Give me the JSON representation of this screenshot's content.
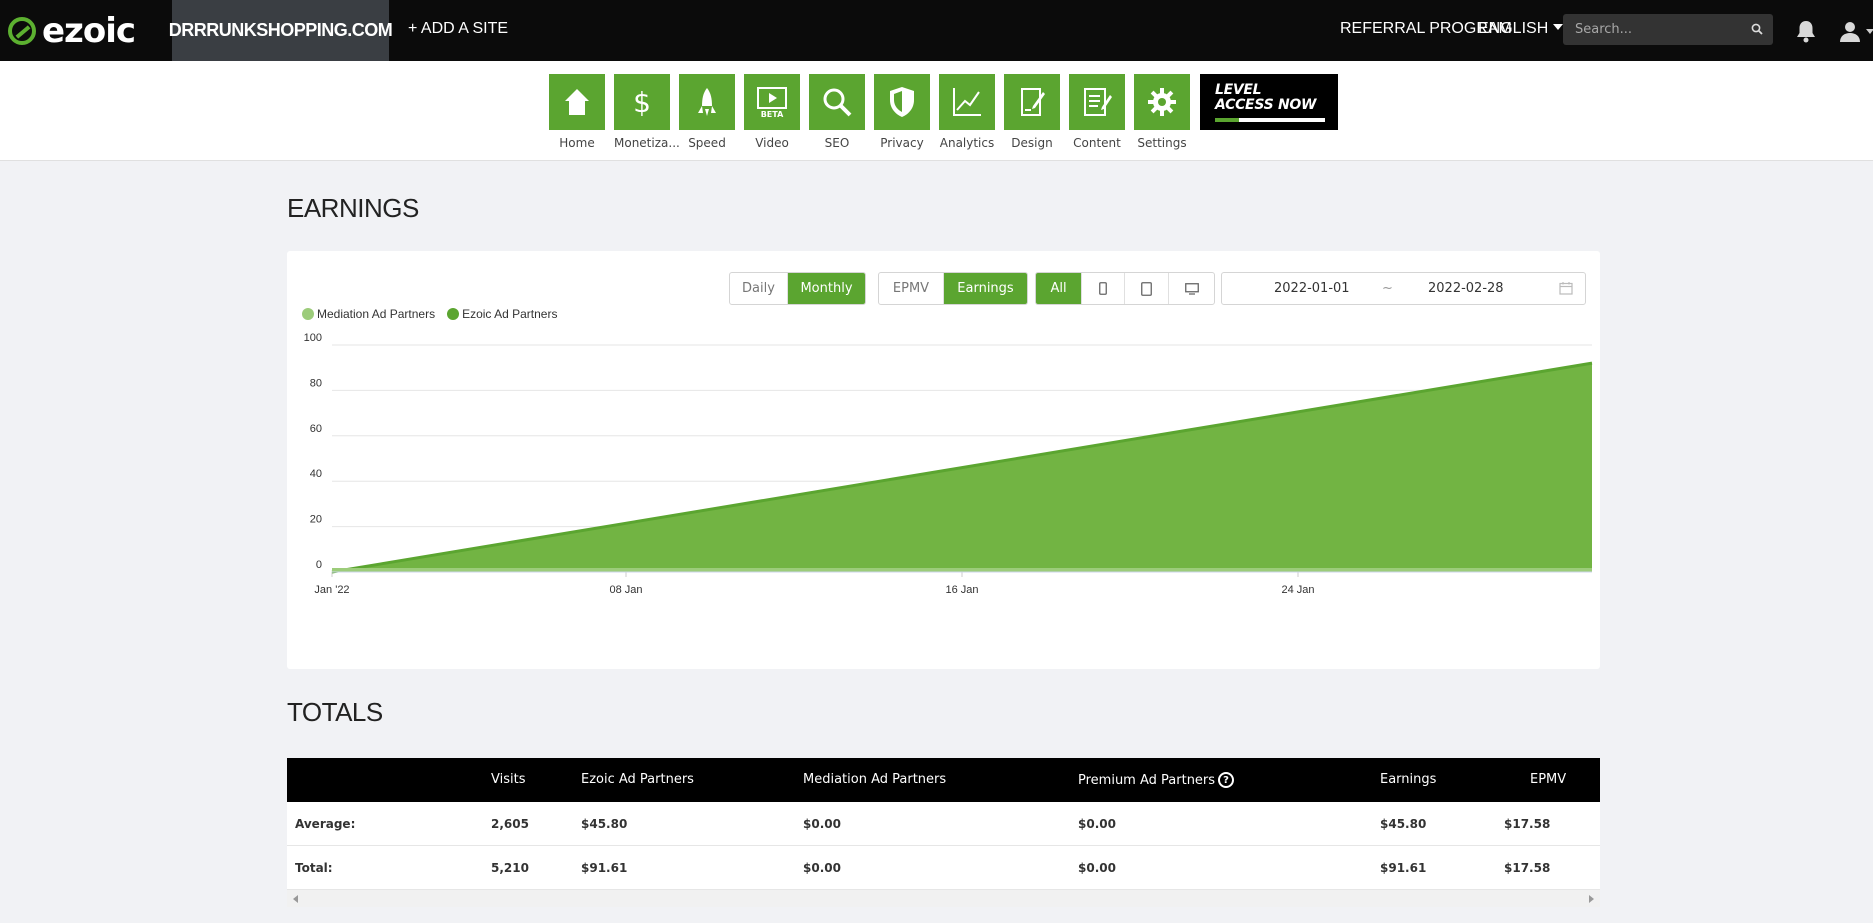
{
  "topbar": {
    "logo_text": "ezoic",
    "site_name": "DRRRUNKSHOPPING.COM",
    "add_site": "+ ADD A SITE",
    "referral": "REFERRAL PROGRAM",
    "language": "ENGLISH",
    "search_placeholder": "Search..."
  },
  "nav": {
    "items": [
      {
        "label": "Home",
        "icon": "home-icon"
      },
      {
        "label": "Monetiza...",
        "icon": "dollar-icon"
      },
      {
        "label": "Speed",
        "icon": "rocket-icon"
      },
      {
        "label": "Video",
        "icon": "video-icon",
        "badge": "BETA"
      },
      {
        "label": "SEO",
        "icon": "magnifier-icon"
      },
      {
        "label": "Privacy",
        "icon": "shield-icon"
      },
      {
        "label": "Analytics",
        "icon": "line-chart-icon"
      },
      {
        "label": "Design",
        "icon": "design-icon"
      },
      {
        "label": "Content",
        "icon": "document-icon"
      },
      {
        "label": "Settings",
        "icon": "gear-icon"
      }
    ],
    "level_banner": {
      "line1": "LEVEL",
      "line2": "ACCESS NOW",
      "progress": 0.22
    }
  },
  "earnings": {
    "heading": "EARNINGS",
    "period_buttons": [
      "Daily",
      "Monthly"
    ],
    "period_active": "Monthly",
    "metric_buttons": [
      "EPMV",
      "Earnings"
    ],
    "metric_active": "Earnings",
    "device_all": "All",
    "date_from": "2022-01-01",
    "date_sep": "~",
    "date_to": "2022-02-28"
  },
  "colors": {
    "accent": "#5ba530",
    "mediation": "#9ccc7a",
    "ezoic": "#5ba530",
    "area_fill": "#72b443"
  },
  "chart_data": {
    "type": "area",
    "x_ticks": [
      "Jan '22",
      "08 Jan",
      "16 Jan",
      "24 Jan"
    ],
    "y_ticks": [
      "100",
      "80",
      "60",
      "40",
      "20",
      "0"
    ],
    "ylim": [
      0,
      100
    ],
    "x_range": [
      "2022-01-01",
      "2022-01-31"
    ],
    "legend_position": "top-left",
    "series": [
      {
        "name": "Mediation Ad Partners",
        "color": "#9ccc7a",
        "points": [
          {
            "x": "2022-01-01",
            "y": 0
          },
          {
            "x": "2022-01-31",
            "y": 0
          }
        ]
      },
      {
        "name": "Ezoic Ad Partners",
        "color": "#5ba530",
        "points": [
          {
            "x": "2022-01-01",
            "y": 0
          },
          {
            "x": "2022-01-31",
            "y": 92
          }
        ]
      }
    ]
  },
  "totals": {
    "heading": "TOTALS",
    "columns": [
      "Visits",
      "Ezoic Ad Partners",
      "Mediation Ad Partners",
      "Premium Ad Partners",
      "Earnings",
      "EPMV"
    ],
    "help_glyph": "?",
    "rows": [
      {
        "label": "Average:",
        "values": [
          "2,605",
          "$45.80",
          "$0.00",
          "$0.00",
          "$45.80",
          "$17.58"
        ]
      },
      {
        "label": "Total:",
        "values": [
          "5,210",
          "$91.61",
          "$0.00",
          "$0.00",
          "$91.61",
          "$17.58"
        ]
      }
    ]
  }
}
